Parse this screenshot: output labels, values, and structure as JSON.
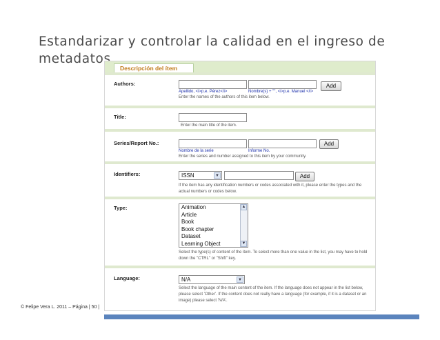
{
  "slide": {
    "title": "Estandarizar y controlar la calidad en el ingreso de metadatos",
    "footer": "© Felipe Vera L. 2011 – Página | 50 |"
  },
  "form": {
    "tab_label": "Descripción del ítem",
    "authors": {
      "label": "Authors:",
      "add_label": "Add",
      "sublabel_last": "Apellido, <i>p.e. Pérez</i>",
      "sublabel_first": "Nombre(s) + \"\", <i>p.e. Manuel </i>",
      "hint": "Enter the names of the authors of this item below."
    },
    "title_field": {
      "label": "Title:",
      "hint": "Enter the main title of the item."
    },
    "series": {
      "label": "Series/Report No.:",
      "add_label": "Add",
      "sublabel_name": "Nombre de la serie",
      "sublabel_number": "Informe No.",
      "hint": "Enter the series and number assigned to this item by your community."
    },
    "identifiers": {
      "label": "Identifiers:",
      "selected": "ISSN",
      "add_label": "Add",
      "hint": "If the item has any identification numbers or codes associated with it, please enter the types and the actual numbers or codes below."
    },
    "type": {
      "label": "Type:",
      "options": [
        "Animation",
        "Article",
        "Book",
        "Book chapter",
        "Dataset",
        "Learning Object"
      ],
      "hint": "Select the type(s) of content of the item. To select more than one value in the list, you may have to hold down the \"CTRL\" or \"Shift\" key."
    },
    "language": {
      "label": "Language:",
      "selected": "N/A",
      "hint": "Select the language of the main content of the item. If the language does not appear in the list below, please select 'Other'. If the content does not really have a language (for example, if it is a dataset or an image) please select 'N/A'."
    }
  },
  "icons": {
    "dropdown": "chevron-down-icon",
    "scroll_up": "arrow-up-icon",
    "scroll_down": "arrow-down-icon"
  },
  "colors": {
    "title_text": "#4a4a4a",
    "tab_text": "#c07a1a",
    "tab_strip": "#dfeccc",
    "sublabel": "#1a2eaa",
    "bottom_bar": "#5b84bd"
  }
}
